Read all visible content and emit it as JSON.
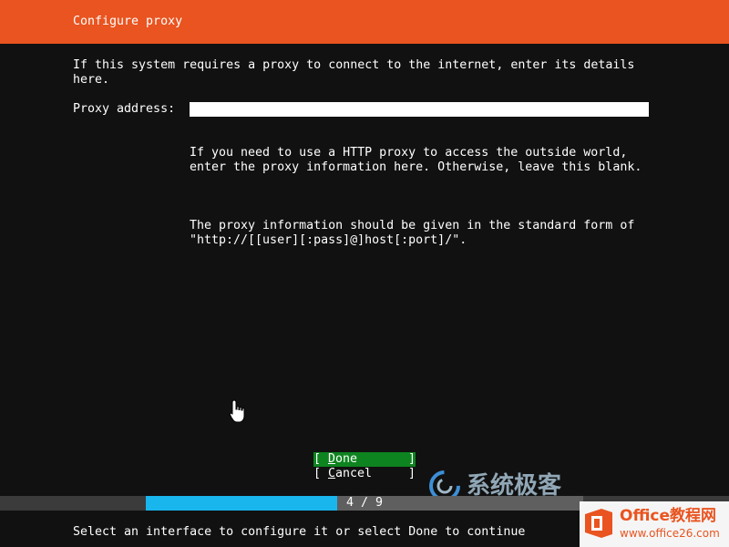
{
  "header": {
    "title": "Configure proxy"
  },
  "intro": "If this system requires a proxy to connect to the internet, enter its details here.",
  "proxy": {
    "label": "Proxy address:",
    "value": "",
    "help": [
      "If you need to use a HTTP proxy to access the outside world, enter the proxy information here. Otherwise, leave this blank.",
      "The proxy information should be given in the standard form of \"http://[[user][:pass]@]host[:port]/\"."
    ]
  },
  "buttons": {
    "open_bracket": "[",
    "close_bracket": "]",
    "done_first": "D",
    "done_rest": "one",
    "cancel_first": "C",
    "cancel_rest": "ancel"
  },
  "progress": {
    "text": "4 / 9",
    "fraction": 0.4375
  },
  "footer": {
    "text": "Select an interface to configure it or select Done to continue"
  },
  "watermarks": {
    "brand_text": "系统极客",
    "site_title": "Office教程网",
    "site_url": "www.office26.com"
  },
  "icons": {
    "pointer": "hand-pointer-icon",
    "brand": "swirl-logo-icon",
    "office": "office-logo-icon"
  },
  "colors": {
    "accent": "#e95420",
    "done_button": "#0e8420",
    "progress_fill": "#19b6ee",
    "background": "#111111"
  }
}
